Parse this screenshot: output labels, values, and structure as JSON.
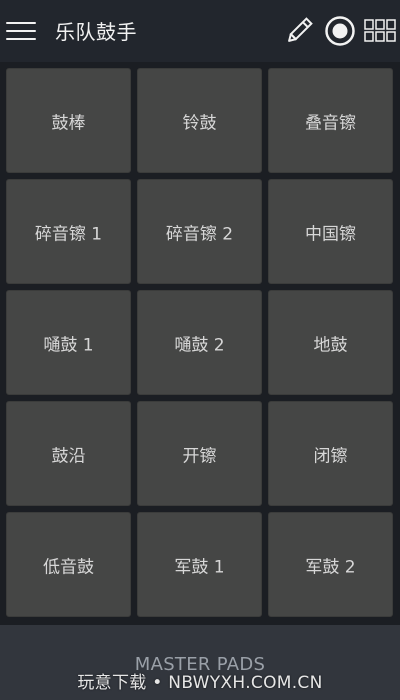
{
  "app": {
    "title": "乐队鼓手"
  },
  "toolbar": {
    "menu_icon": "hamburger-icon",
    "edit_icon": "pencil-icon",
    "record_icon": "record-icon",
    "grid_icon": "grid-icon"
  },
  "pads": [
    {
      "label": "鼓棒"
    },
    {
      "label": "铃鼓"
    },
    {
      "label": "叠音镲"
    },
    {
      "label": "碎音镲 1"
    },
    {
      "label": "碎音镲 2"
    },
    {
      "label": "中国镲"
    },
    {
      "label": "嗵鼓 1"
    },
    {
      "label": "嗵鼓 2"
    },
    {
      "label": "地鼓"
    },
    {
      "label": "鼓沿"
    },
    {
      "label": "开镲"
    },
    {
      "label": "闭镲"
    },
    {
      "label": "低音鼓"
    },
    {
      "label": "军鼓 1"
    },
    {
      "label": "军鼓 2"
    }
  ],
  "bottom": {
    "label": "MASTER PADS"
  },
  "watermark": {
    "text": "玩意下载 • NBWYXH.COM.CN"
  },
  "colors": {
    "topbar": "#22262d",
    "pad": "#454645",
    "background": "#1b1e23",
    "bottombar": "#32363d"
  }
}
